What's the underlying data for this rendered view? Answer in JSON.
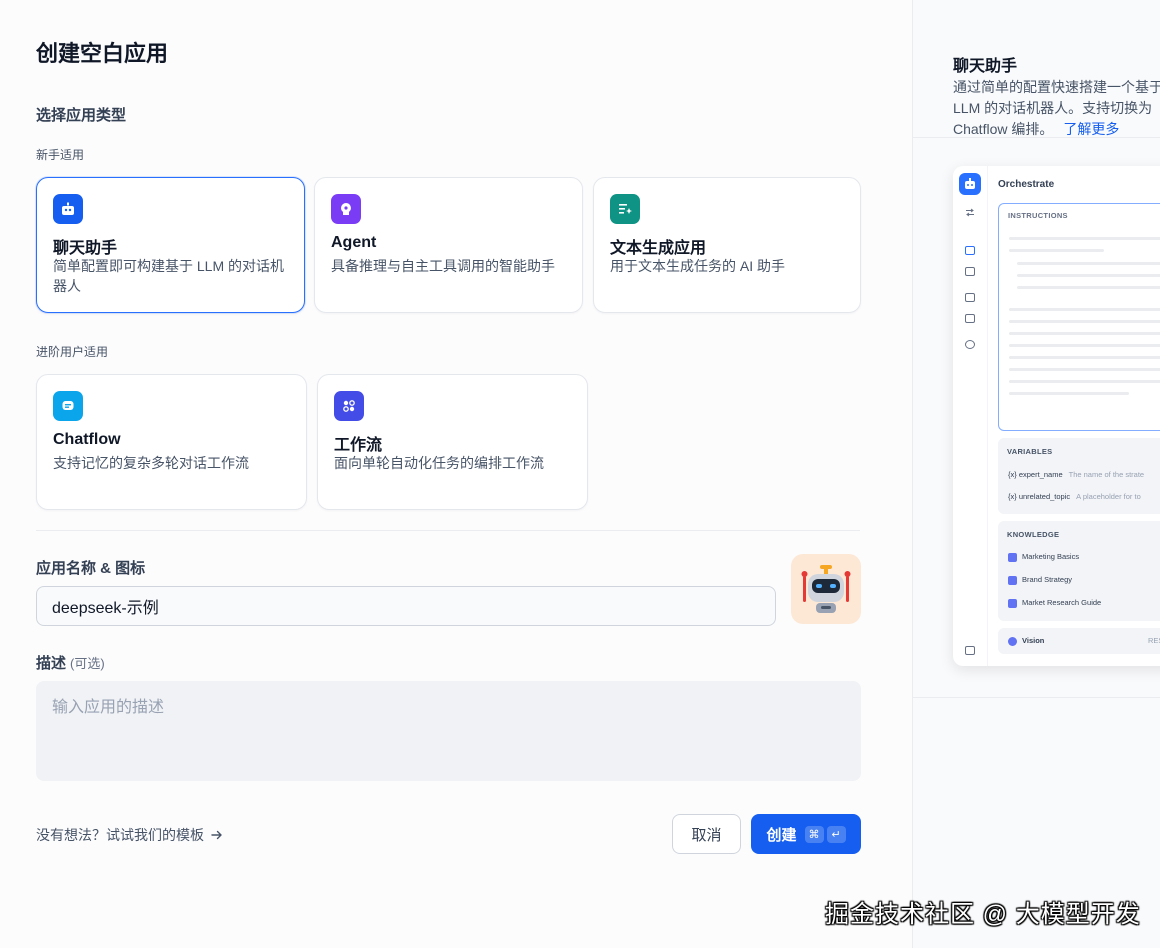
{
  "dialog": {
    "title": "创建空白应用",
    "section_app_type": "选择应用类型",
    "group_beginner": "新手适用",
    "group_advanced": "进阶用户适用"
  },
  "app_types": {
    "beginner": [
      {
        "name": "聊天助手",
        "desc": "简单配置即可构建基于 LLM 的对话机器人",
        "icon": "chatbot-icon",
        "color": "#155eef",
        "selected": true
      },
      {
        "name": "Agent",
        "desc": "具备推理与自主工具调用的智能助手",
        "icon": "agent-icon",
        "color": "#7a3df5",
        "selected": false
      },
      {
        "name": "文本生成应用",
        "desc": "用于文本生成任务的 AI 助手",
        "icon": "text-generation-icon",
        "color": "#0e9384",
        "selected": false
      }
    ],
    "advanced": [
      {
        "name": "Chatflow",
        "desc": "支持记忆的复杂多轮对话工作流",
        "icon": "chatflow-icon",
        "color": "#0ba5ec",
        "selected": false
      },
      {
        "name": "工作流",
        "desc": "面向单轮自动化任务的编排工作流",
        "icon": "workflow-icon",
        "color": "#444ce7",
        "selected": false
      }
    ]
  },
  "form": {
    "name_label": "应用名称 & 图标",
    "name_value": "deepseek-示例",
    "avatar_icon": "robot-emoji-icon",
    "desc_label": "描述",
    "desc_optional": "(可选)",
    "desc_placeholder": "输入应用的描述"
  },
  "footer": {
    "template_hint": "没有想法？试试我们的模板",
    "cancel": "取消",
    "create": "创建",
    "shortcut_cmd": "⌘",
    "shortcut_enter": "↵"
  },
  "preview": {
    "title": "聊天助手",
    "desc": "通过简单的配置快速搭建一个基于 LLM 的对话机器人。支持切换为 Chatflow 编排。",
    "learn_more": "了解更多",
    "mock": {
      "header": "Orchestrate",
      "instructions_label": "INSTRUCTIONS",
      "variables_label": "VARIABLES",
      "variables": [
        {
          "name": "{x} expert_name",
          "hint": "The name of the strate"
        },
        {
          "name": "{x} unrelated_topic",
          "hint": "A placeholder for to"
        }
      ],
      "knowledge_label": "KNOWLEDGE",
      "knowledge": [
        "Marketing Basics",
        "Brand Strategy",
        "Market Research Guide"
      ],
      "vision_label": "Vision",
      "vision_action": "RES"
    }
  },
  "watermark": "掘金技术社区 @ 大模型开发"
}
